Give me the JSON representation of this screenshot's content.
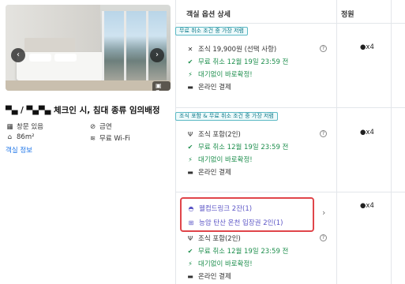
{
  "photo": {
    "photo_count": "7"
  },
  "room": {
    "title": "체크인 시, 침대 종류 임의배정",
    "amenities": [
      {
        "icon": "view-icon",
        "label": "창문 있음"
      },
      {
        "icon": "no-smoking-icon",
        "label": "금연"
      },
      {
        "icon": "area-icon",
        "label": "86m²"
      },
      {
        "icon": "wifi-icon",
        "label": "무료 Wi-Fi"
      }
    ],
    "info_link": "객실 정보"
  },
  "table": {
    "col_option": "객실 옵션 상세",
    "col_capacity": "정원"
  },
  "options": [
    {
      "tag": "무료 취소 조건 중 가장 저렴",
      "breakfast": "조식 19,900원 (선택 사항)",
      "cancel": "무료 취소 12월 19일 23:59 전",
      "instant": "대기없이 바로확정!",
      "payment": "온라인 결제",
      "capacity": "x4"
    },
    {
      "tag": "조식 포함 & 무료 취소 조건 중 가장 저렴",
      "breakfast": "조식 포함(2인)",
      "cancel": "무료 취소 12월 19일 23:59 전",
      "instant": "대기없이 바로확정!",
      "payment": "온라인 결제",
      "capacity": "x4"
    },
    {
      "perk1": "웰컴드링크 2잔(1)",
      "perk2": "능암 탄산 온천 입장권 2인(1)",
      "breakfast": "조식 포함(2인)",
      "cancel": "무료 취소 12월 19일 23:59 전",
      "instant": "대기없이 바로확정!",
      "payment": "온라인 결제",
      "capacity": "x4"
    }
  ]
}
